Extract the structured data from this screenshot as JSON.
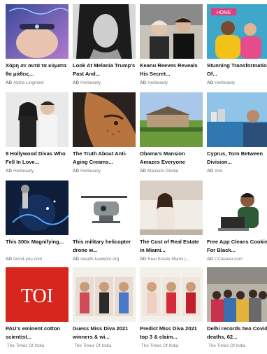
{
  "cards": [
    {
      "title": "Χάρη σε αυτά τα κύματα θα μάθεις...",
      "ad": "AD",
      "source": "Alpha Lingmind"
    },
    {
      "title": "Look At Melania Trump's Past And...",
      "ad": "AD",
      "source": "Herbeauty"
    },
    {
      "title": "Keanu Reeves Reveals His Secret...",
      "ad": "AD",
      "source": "Herbeauty"
    },
    {
      "title": "Stunning Transformation Of...",
      "ad": "AD",
      "source": "Herbeauty",
      "thumb_text": "HOME"
    },
    {
      "title": "9 Hollywood Divas Who Fell In Love...",
      "ad": "AD",
      "source": "Herbeauty"
    },
    {
      "title": "The Truth About Anti-Aging Creams...",
      "ad": "AD",
      "source": "Herbeauty"
    },
    {
      "title": "Obama's Mansion Amazes Everyone",
      "ad": "AD",
      "source": "Mansion Global"
    },
    {
      "title": "Cyprus, Torn Between Division...",
      "ad": "AD",
      "source": "Arte"
    },
    {
      "title": "This 300x Magnifying...",
      "ad": "AD",
      "source": "tech4-you.com"
    },
    {
      "title": "This military helicopter drone w...",
      "ad": "AD",
      "source": "stealth-hawkpro.org"
    },
    {
      "title": "The Cost of Real Estate in Miami...",
      "ad": "AD",
      "source": "Real Estate Miami |..."
    },
    {
      "title": "Free App Cleans Cookies For Black...",
      "ad": "AD",
      "source": "CCleaner.com"
    },
    {
      "title": "PAU's eminent cotton scientist...",
      "ad": "",
      "source": "The Times Of India",
      "thumb_text": "TOI"
    },
    {
      "title": "Guess Miss Diva 2021 winners & wi...",
      "ad": "",
      "source": "The Times Of India"
    },
    {
      "title": "Predict Miss Diva 2021 top 3 & claim...",
      "ad": "",
      "source": "The Times Of India"
    },
    {
      "title": "Delhi records two Covid deaths, 62...",
      "ad": "",
      "source": "The Times Of India"
    }
  ]
}
